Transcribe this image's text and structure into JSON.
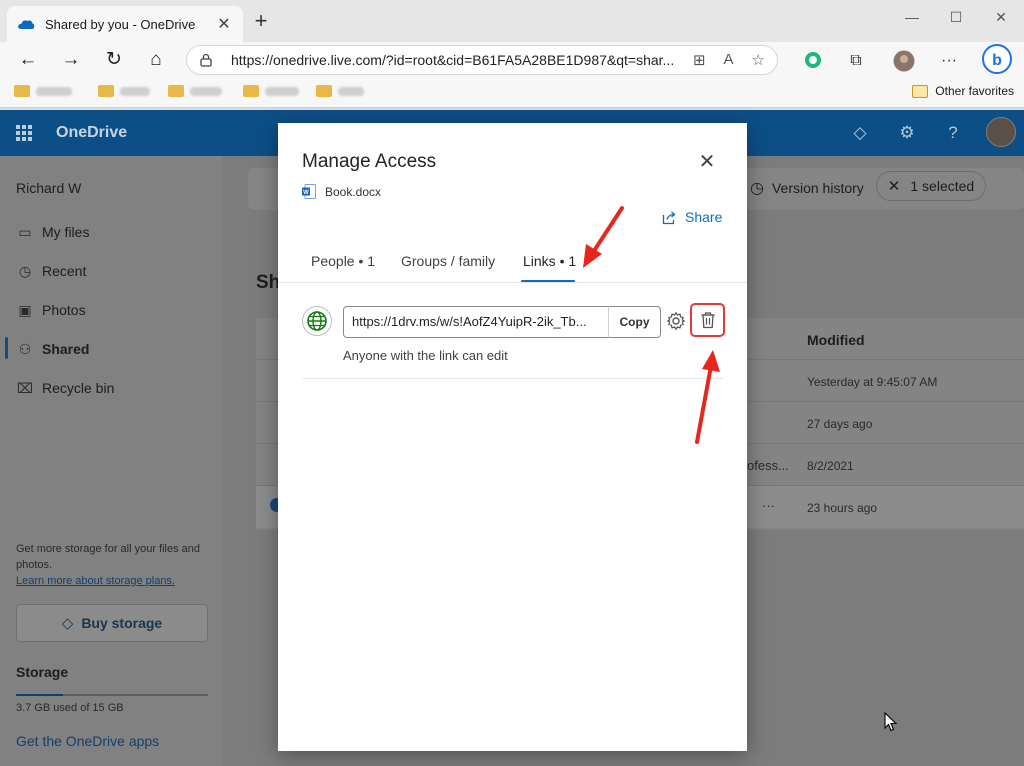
{
  "browser": {
    "tab_title": "Shared by you - OneDrive",
    "tab_close": "✕",
    "new_tab": "+",
    "window_controls": [
      "—",
      "☐",
      "✕"
    ],
    "address": "https://onedrive.live.com/?id=root&cid=B61FA5A28BE1D987&qt=shar...",
    "other_favorites": "Other favorites"
  },
  "app": {
    "name": "OneDrive",
    "user_name": "Richard W",
    "nav": [
      {
        "label": "My files",
        "icon": "folder-icon"
      },
      {
        "label": "Recent",
        "icon": "clock-icon"
      },
      {
        "label": "Photos",
        "icon": "image-icon"
      },
      {
        "label": "Shared",
        "icon": "people-icon"
      },
      {
        "label": "Recycle bin",
        "icon": "recycle-bin-icon"
      }
    ],
    "storage_promo": "Get more storage for all your files and photos.",
    "storage_link": "Learn more about storage plans.",
    "buy_storage": "Buy storage",
    "storage_title": "Storage",
    "storage_used": "3.7 GB used of 15 GB",
    "storage_fraction": 0.247,
    "get_apps": "Get the OneDrive apps",
    "version_history": "Version history",
    "selected_label": "1 selected",
    "page_heading_fragment": "Sh",
    "list": {
      "modified_header": "Modified",
      "row_fragment_3": "ofess...",
      "row_fragment_4": "···",
      "dates": [
        "Yesterday at 9:45:07 AM",
        "27 days ago",
        "8/2/2021",
        "23 hours ago"
      ]
    }
  },
  "dialog": {
    "title": "Manage Access",
    "file_name": "Book.docx",
    "share_label": "Share",
    "tabs": [
      {
        "label": "People • 1"
      },
      {
        "label": "Groups / family"
      },
      {
        "label": "Links • 1",
        "active": true
      }
    ],
    "link_url": "https://1drv.ms/w/s!AofZ4YuipR-2ik_Tb...",
    "copy_label": "Copy",
    "link_description": "Anyone with the link can edit"
  },
  "colors": {
    "accent": "#0f6cbd",
    "header": "#0c4f86",
    "highlight": "#e03a3a"
  }
}
